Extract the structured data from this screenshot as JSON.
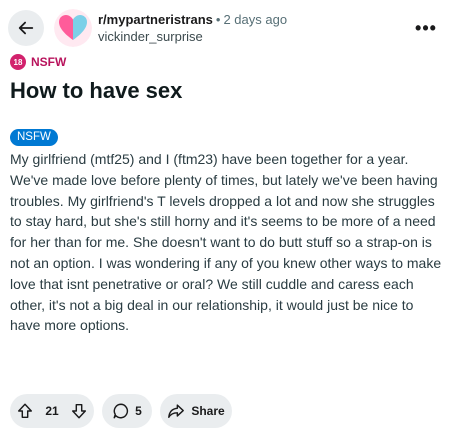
{
  "header": {
    "subreddit": "r/mypartneristrans",
    "separator": "•",
    "age": "2 days ago",
    "username": "vickinder_surprise",
    "more_label": "•••"
  },
  "tags": {
    "nsfw_badge": "18",
    "nsfw_label": "NSFW"
  },
  "post": {
    "title": "How to have sex",
    "flair": "NSFW",
    "body": "My girlfriend (mtf25) and I (ftm23) have been together for a year. We've made love before plenty of times, but lately we've been having troubles. My girlfriend's T levels dropped a lot and now she struggles to stay hard, but she's still horny and it's seems to be more of a need for her than for me. She doesn't want to do butt stuff so a strap-on is not an option. I was wondering if any of you knew other ways to make love that isnt penetrative or oral? We still cuddle and caress each other, it's not a big deal in our relationship, it would just be nice to have more options."
  },
  "actions": {
    "vote_count": "21",
    "comment_count": "5",
    "share_label": "Share"
  },
  "colors": {
    "pill_bg": "#eaedef",
    "nsfw": "#d2226d",
    "flair": "#0079d3",
    "avatar_left": "#ff5c9a",
    "avatar_right": "#7cd0e8"
  }
}
